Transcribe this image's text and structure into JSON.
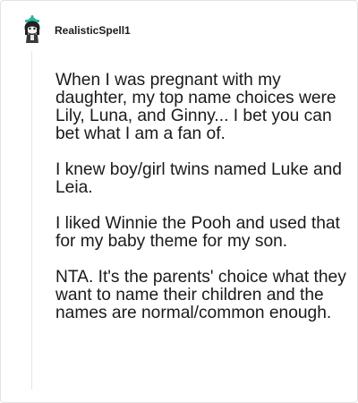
{
  "comment": {
    "username": "RealisticSpell1",
    "avatar_icon": "snoo-avatar-icon",
    "paragraphs": [
      "When I was pregnant with my daughter, my top name choices were Lily, Luna, and Ginny... I bet you can bet what I am a fan of.",
      "I knew boy/girl twins named Luke and Leia.",
      "I liked Winnie the Pooh and used that for my baby theme for my son.",
      "NTA. It's the parents' choice what they want to name their children and the names are normal/common enough."
    ]
  },
  "colors": {
    "text": "#1a1a1b",
    "border": "#e2e2e2",
    "thread_line": "#e6e6e6",
    "avatar_accent": "#2bb5a0"
  }
}
